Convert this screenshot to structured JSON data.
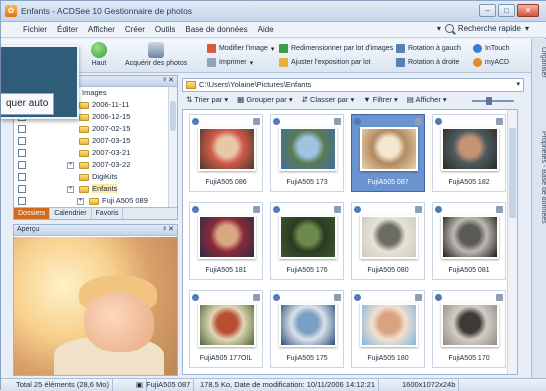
{
  "window": {
    "title": "Enfants - ACDSee 10 Gestionnaire de photos",
    "controls": [
      "–",
      "□",
      "✕"
    ]
  },
  "menu": {
    "items": [
      "Fichier",
      "Éditer",
      "Afficher",
      "Créer",
      "Outils",
      "Base de données",
      "Aide"
    ],
    "search_label": "Recherche rapide"
  },
  "toolbar": {
    "up_label": "Haut",
    "acquire_label": "Acquérir des photos",
    "modify_label": "Modifier l'image",
    "print_label": "Imprimer",
    "resize_label": "Redimensionner par lot d'images",
    "exposure_label": "Ajuster l'exposition par lot",
    "rotate_left_label": "Rotation à gauch",
    "rotate_right_label": "Rotation à droite",
    "intouch_label": "InTouch",
    "myacd_label": "myACD"
  },
  "tooltip": {
    "label": "quer auto"
  },
  "folders_panel": {
    "items": [
      {
        "label": "Images",
        "level": 0
      },
      {
        "label": "2006-11-11",
        "level": 1
      },
      {
        "label": "2006-12-15",
        "level": 1
      },
      {
        "label": "2007-02-15",
        "level": 1
      },
      {
        "label": "2007-03-15",
        "level": 1
      },
      {
        "label": "2007-03-21",
        "level": 1
      },
      {
        "label": "2007-03-22",
        "level": 1
      },
      {
        "label": "DigiKits",
        "level": 1
      },
      {
        "label": "Enfants",
        "level": 1
      },
      {
        "label": "Fuji A505 089",
        "level": 2
      }
    ],
    "tabs": [
      "Dossiers",
      "Calendrier",
      "Favoris"
    ]
  },
  "preview_panel": {
    "title": "Aperçu"
  },
  "address": {
    "path": "C:\\Users\\Yolaine\\Pictures\\Enfants"
  },
  "viewbar": {
    "sort_label": "Trier par",
    "group_label": "Grouper par",
    "rank_label": "Classer par",
    "filter_label": "Filtrer",
    "view_label": "Afficher"
  },
  "thumbnails": [
    {
      "caption": "FujiA505 086",
      "selected": false,
      "colors": [
        "#4b3a2c",
        "#e8c6a8",
        "#cf5a4a"
      ]
    },
    {
      "caption": "FujiA505 173",
      "selected": false,
      "colors": [
        "#3e6fa5",
        "#9dc4e2",
        "#5a7a52"
      ]
    },
    {
      "caption": "FujiA505 087",
      "selected": true,
      "colors": [
        "#e8d2b0",
        "#f4e6cf",
        "#b28a60"
      ]
    },
    {
      "caption": "FujiA505 182",
      "selected": false,
      "colors": [
        "#2f2a25",
        "#c59472",
        "#4d5a60"
      ]
    },
    {
      "caption": "FujiA505 181",
      "selected": false,
      "colors": [
        "#2a2c4a",
        "#d9a684",
        "#8a2a38"
      ]
    },
    {
      "caption": "FujiA505 176",
      "selected": false,
      "colors": [
        "#3b5a2d",
        "#6d8a4a",
        "#2a3b22"
      ]
    },
    {
      "caption": "FujiA505 080",
      "selected": false,
      "colors": [
        "#cfc9bd",
        "#6c6c62",
        "#e7e3d7"
      ]
    },
    {
      "caption": "FujiA505 081",
      "selected": false,
      "colors": [
        "#1e1c1a",
        "#5c5a56",
        "#bdb9b2"
      ]
    },
    {
      "caption": "FujiA505 177OIL",
      "selected": false,
      "colors": [
        "#4d6a3a",
        "#b84e33",
        "#e2d5b6"
      ]
    },
    {
      "caption": "FujiA505 175",
      "selected": false,
      "colors": [
        "#2c4d7a",
        "#7a9fc4",
        "#d8e1ea"
      ]
    },
    {
      "caption": "FujiA505 180",
      "selected": false,
      "colors": [
        "#7fb6df",
        "#d8a283",
        "#f2e0cf"
      ]
    },
    {
      "caption": "FujiA505 170",
      "selected": false,
      "colors": [
        "#8d8b8a",
        "#3d3a38",
        "#d4cdc4"
      ]
    }
  ],
  "side_tabs": [
    "Organiser",
    "Propriétés - Base de données"
  ],
  "status": {
    "total": "Total 25 éléments  (28,6 Mo)",
    "file": "FujiA505 087",
    "info": "178,5 Ko, Date de modification: 10/11/2006 14:12:21",
    "dimensions": "1600x1072x24b"
  }
}
